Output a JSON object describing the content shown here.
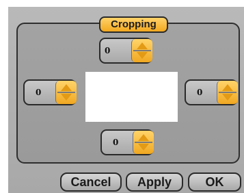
{
  "dialog": {
    "title": "Cropping"
  },
  "spinners": {
    "top": {
      "value": "0"
    },
    "left": {
      "value": "0"
    },
    "right": {
      "value": "0"
    },
    "bottom": {
      "value": "0"
    }
  },
  "buttons": {
    "cancel": "Cancel",
    "apply": "Apply",
    "ok": "OK"
  },
  "colors": {
    "accent": "#f3a81f",
    "panel": "#9e9e9e",
    "border": "#2a2a2a"
  }
}
